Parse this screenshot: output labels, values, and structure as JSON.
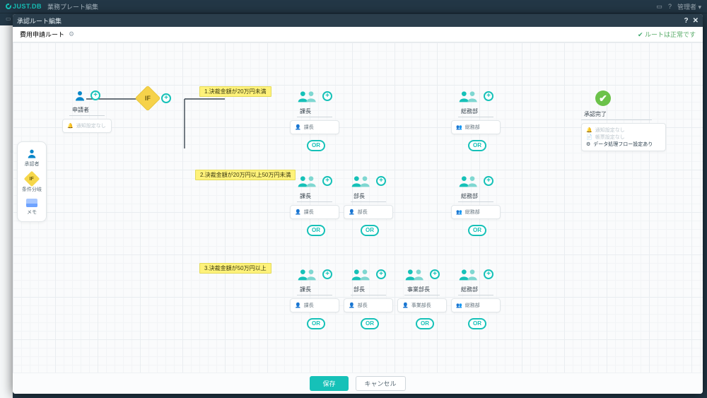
{
  "app": {
    "brand": "JUST.DB",
    "section": "業務プレート編集",
    "user_label": "管理者"
  },
  "modal": {
    "title": "承認ルート編集",
    "route_name": "費用申請ルート",
    "status_ok": "ルートは正常です",
    "save": "保存",
    "cancel": "キャンセル"
  },
  "palette": {
    "approver": "承認者",
    "condition": "条件分岐",
    "memo": "メモ"
  },
  "nodes": {
    "applicant": {
      "label": "申請者",
      "detail": "通知設定なし"
    },
    "decision": {
      "label": "IF"
    },
    "done": {
      "label": "承認完了",
      "detail1": "通知設定なし",
      "detail2": "帳票設定なし",
      "detail3": "データ処理フロー設定あり"
    }
  },
  "conditions": {
    "c1": "1.決裁金額が20万円未満",
    "c2": "2.決裁金額が20万円以上50万円未満",
    "c3": "3.決裁金額が50万円以上"
  },
  "roles": {
    "kacho": {
      "label": "課長",
      "value": "課長"
    },
    "bucho": {
      "label": "部長",
      "value": "部長"
    },
    "jigyobucho": {
      "label": "事業部長",
      "value": "事業部長"
    },
    "somu": {
      "label": "総務部",
      "value": "総務部"
    }
  },
  "or_label": "OR",
  "colors": {
    "accent": "#16c1b8",
    "condition": "#f6d24a",
    "done": "#6cc24a"
  }
}
